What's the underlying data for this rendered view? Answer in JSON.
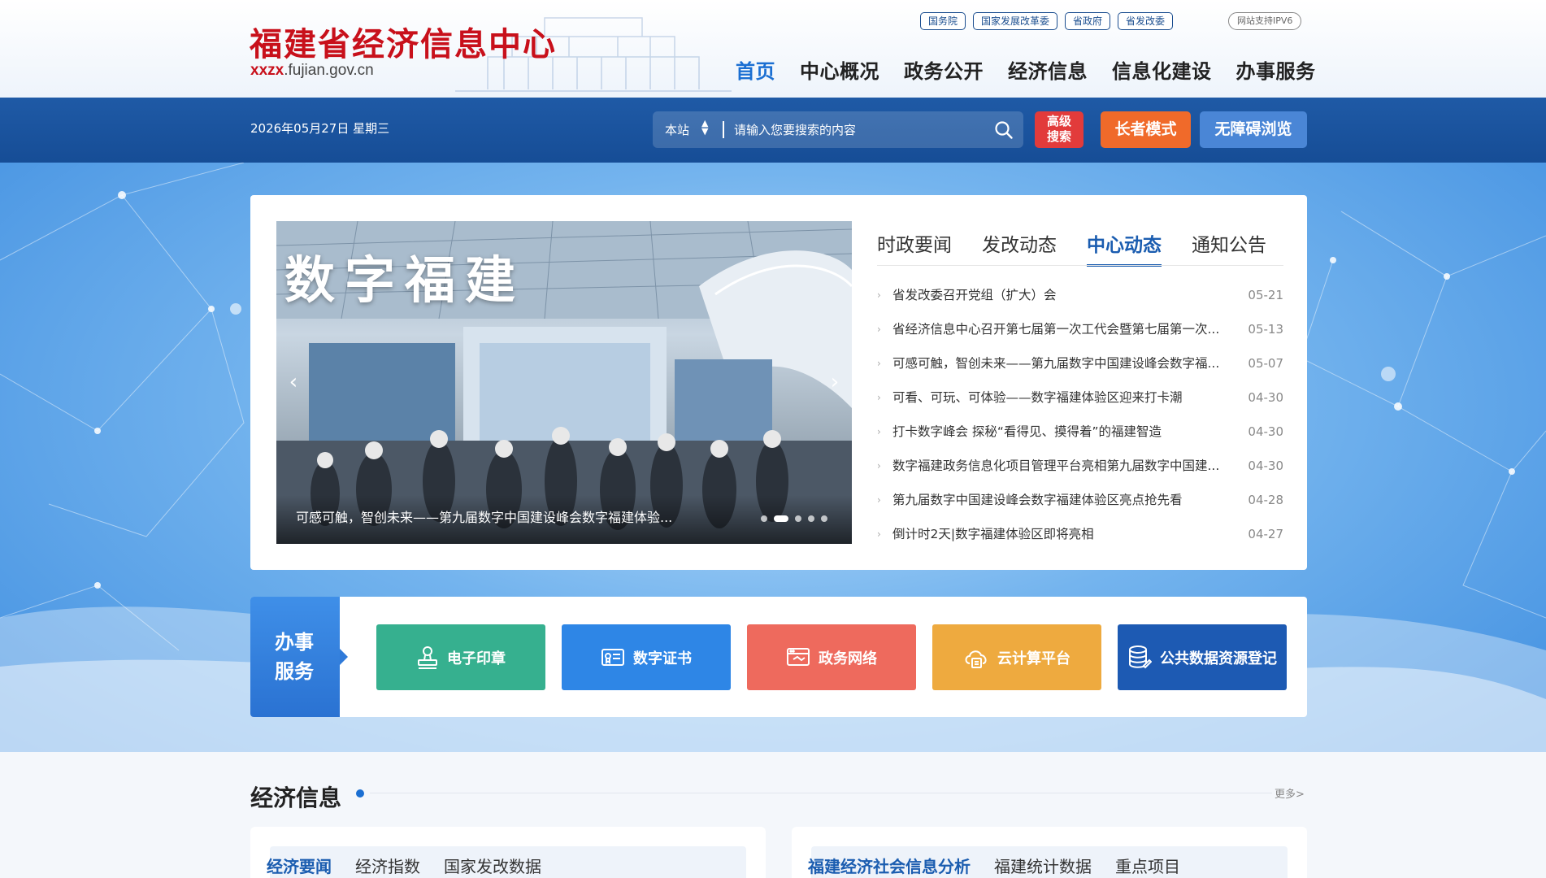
{
  "header": {
    "site_title": "福建省经济信息中心",
    "domain_prefix": "xxzx",
    "domain_rest": ".fujian.gov.cn",
    "quicklinks": [
      "国务院",
      "国家发展改革委",
      "省政府",
      "省发改委"
    ],
    "ipv6_badge": "网站支持IPV6",
    "nav": [
      "首页",
      "中心概况",
      "政务公开",
      "经济信息",
      "信息化建设",
      "办事服务"
    ]
  },
  "toolbar": {
    "date": "2026年05月27日 星期三",
    "search_scope": "本站",
    "search_placeholder": "请输入您要搜索的内容",
    "advanced_search": [
      "高级",
      "搜索"
    ],
    "elder_mode": "长者模式",
    "accessible_browse": "无障碍浏览"
  },
  "slider": {
    "banner_text": "数字福建",
    "caption": "可感可触，智创未来——第九届数字中国建设峰会数字福建体验...",
    "dot_count": 5,
    "active_dot": 1
  },
  "news": {
    "tabs": [
      "时政要闻",
      "发改动态",
      "中心动态",
      "通知公告"
    ],
    "active_tab": 2,
    "items": [
      {
        "title": "省发改委召开党组（扩大）会",
        "date": "05-21"
      },
      {
        "title": "省经济信息中心召开第七届第一次工代会暨第七届第一次...",
        "date": "05-13"
      },
      {
        "title": "可感可触，智创未来——第九届数字中国建设峰会数字福...",
        "date": "05-07"
      },
      {
        "title": "可看、可玩、可体验——数字福建体验区迎来打卡潮",
        "date": "04-30"
      },
      {
        "title": "打卡数字峰会 探秘“看得见、摸得着”的福建智造",
        "date": "04-30"
      },
      {
        "title": "数字福建政务信息化项目管理平台亮相第九届数字中国建...",
        "date": "04-30"
      },
      {
        "title": "第九届数字中国建设峰会数字福建体验区亮点抢先看",
        "date": "04-28"
      },
      {
        "title": "倒计时2天|数字福建体验区即将亮相",
        "date": "04-27"
      }
    ]
  },
  "services": {
    "label": [
      "办事",
      "服务"
    ],
    "buttons": [
      {
        "label": "电子印章",
        "icon": "stamp-icon",
        "color": "#36b08f"
      },
      {
        "label": "数字证书",
        "icon": "certificate-icon",
        "color": "#2e86e6"
      },
      {
        "label": "政务网络",
        "icon": "network-icon",
        "color": "#ee6a5d"
      },
      {
        "label": "云计算平台",
        "icon": "cloud-icon",
        "color": "#eeaa3f"
      },
      {
        "label": "公共数据资源登记",
        "icon": "database-icon",
        "color": "#1d5ab3"
      }
    ]
  },
  "econ": {
    "title": "经济信息",
    "more": "更多>",
    "left_tabs": [
      "经济要闻",
      "经济指数",
      "国家发改数据"
    ],
    "right_tabs": [
      "福建经济社会信息分析",
      "福建统计数据",
      "重点项目"
    ]
  },
  "colors": {
    "brand_red": "#c8101b",
    "nav_active": "#1b6fd2",
    "bar_blue": "#1f5aa6",
    "advanced_search": "#e23b3b",
    "elder_mode": "#f06a2a",
    "accessible": "#4a86d6"
  }
}
